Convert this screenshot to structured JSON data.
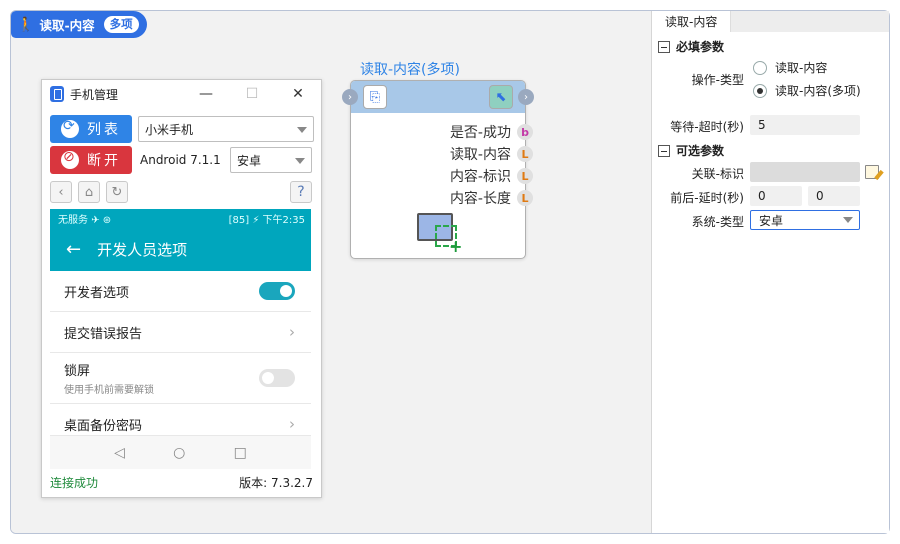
{
  "pill": {
    "label": "读取-内容",
    "badge": "多项"
  },
  "window": {
    "title": "手机管理",
    "list_button": "列表",
    "disconnect_button": "断开",
    "device_select": "小米手机",
    "android_version": "Android 7.1.1",
    "os_select": "安卓",
    "help": "?",
    "status": "连接成功",
    "version": "版本: 7.3.2.7"
  },
  "phone": {
    "status_left": "无服务 ✈ ⊛",
    "status_right": "[85] ⚡ 下午2:35",
    "appbar_title": "开发人员选项",
    "settings": [
      {
        "title": "开发者选项",
        "subtitle": ""
      },
      {
        "title": "提交错误报告",
        "subtitle": ""
      },
      {
        "title": "锁屏",
        "subtitle": "使用手机前需要解锁"
      },
      {
        "title": "桌面备份密码",
        "subtitle": ""
      }
    ]
  },
  "node": {
    "title": "读取-内容(多项)",
    "outputs": [
      {
        "label": "是否-成功",
        "type": "b"
      },
      {
        "label": "读取-内容",
        "type": "L"
      },
      {
        "label": "内容-标识",
        "type": "L"
      },
      {
        "label": "内容-长度",
        "type": "L"
      }
    ]
  },
  "panel": {
    "tab": "读取-内容",
    "required_section": "必填参数",
    "optional_section": "可选参数",
    "op_type_label": "操作-类型",
    "op_options": [
      "读取-内容",
      "读取-内容(多项)"
    ],
    "selected_option_index": 1,
    "timeout_label": "等待-超时(秒)",
    "timeout_value": "5",
    "assoc_label": "关联-标识",
    "assoc_value": "",
    "delay_label": "前后-延时(秒)",
    "delay_before": "0",
    "delay_after": "0",
    "system_label": "系统-类型",
    "system_value": "安卓"
  },
  "colors": {
    "accent": "#2f6fe2",
    "phone_bar": "#00a6bd",
    "danger": "#d9363e",
    "success": "#1f8a3b"
  }
}
